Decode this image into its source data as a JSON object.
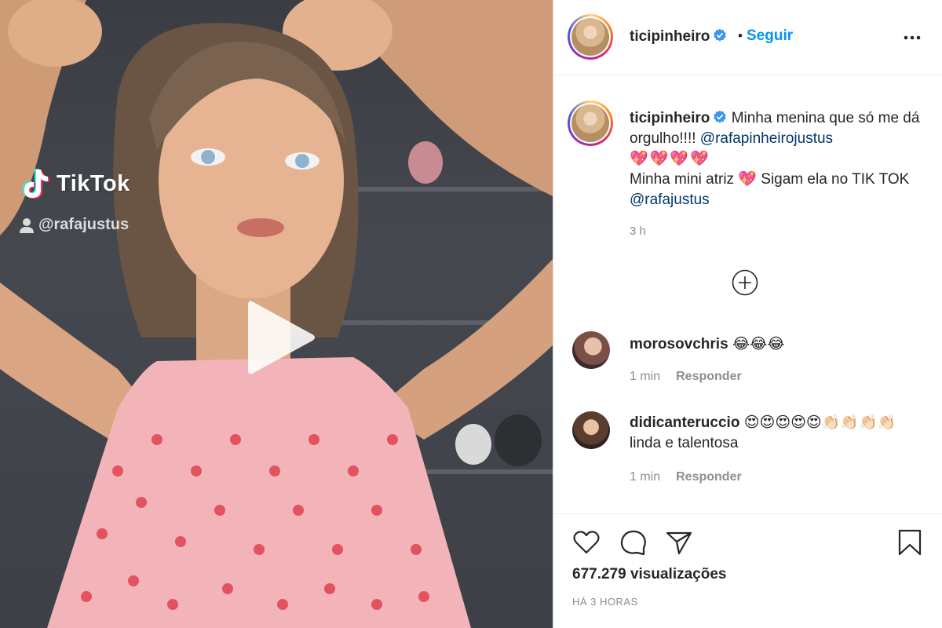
{
  "video": {
    "tiktok_brand": "TikTok",
    "tiktok_handle": "@rafajustus",
    "play_icon": "play-icon"
  },
  "post_header": {
    "username": "ticipinheiro",
    "verified_icon": "verified-badge-icon",
    "separator": "•",
    "follow_label": "Seguir",
    "more_icon": "more-options-icon"
  },
  "caption": {
    "username": "ticipinheiro",
    "text_1": "Minha menina que só me dá orgulho!!!!",
    "mention_1": "@rafapinheirojustus",
    "hearts": "💖💖💖💖",
    "text_2": "Minha mini atriz",
    "heart_2": "💖",
    "text_3": "Sigam ela no TIK TOK",
    "mention_2": "@rafajustus",
    "time": "3 h"
  },
  "load_more_icon": "plus-circle-icon",
  "comments": [
    {
      "username": "morosovchris",
      "text": "😂😂😂",
      "time": "1 min",
      "reply": "Responder"
    },
    {
      "username": "didicanteruccio",
      "text": "😍😍😍😍😍👏🏻👏🏻👏🏻👏🏻 linda e talentosa",
      "time": "1 min",
      "reply": "Responder"
    }
  ],
  "actions": {
    "like_icon": "heart-icon",
    "comment_icon": "comment-icon",
    "share_icon": "share-icon",
    "save_icon": "bookmark-icon",
    "views": "677.279 visualizações",
    "age": "HÁ 3 HORAS"
  },
  "colors": {
    "link": "#0095f6",
    "mention": "#00376b",
    "muted": "#8e8e8e",
    "text": "#262626"
  }
}
